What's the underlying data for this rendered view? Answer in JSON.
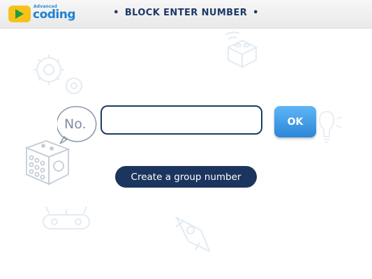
{
  "app": {
    "logo_small": "Advanced",
    "logo_main": "coding",
    "title": "BLOCK ENTER NUMBER",
    "title_bullet": "•"
  },
  "form": {
    "number_prefix": "No.",
    "number_value": "",
    "ok_label": "OK",
    "group_button_label": "Create a group number"
  },
  "icons": {
    "logo": "play-icon",
    "background": [
      "gear-icon",
      "building-block-icon",
      "dice-icon",
      "lightbulb-icon",
      "rocket-icon",
      "robot-icon"
    ]
  },
  "colors": {
    "accent": "#1e82d2",
    "navy": "#1c355f",
    "ok_button": "#3d9be6",
    "logo_badge": "#f6c21a"
  }
}
